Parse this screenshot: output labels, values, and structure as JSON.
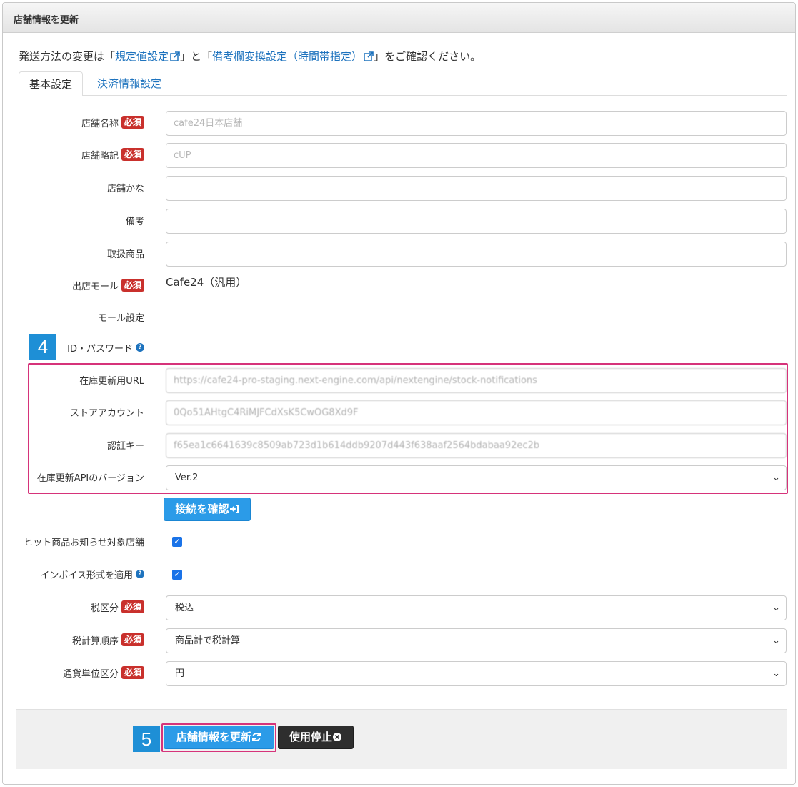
{
  "header": {
    "title": "店舗情報を更新"
  },
  "notice": {
    "prefix": "発送方法の変更は「",
    "link1": "規定値設定",
    "middle": "」と「",
    "link2": "備考欄変換設定（時間帯指定）",
    "suffix": "」をご確認ください。"
  },
  "tabs": {
    "basic": "基本設定",
    "payment": "決済情報設定"
  },
  "required_label": "必須",
  "fields": {
    "shop_name": {
      "label": "店舗名称",
      "value": "cafe24日本店舗"
    },
    "shop_abbr": {
      "label": "店舗略記",
      "value": "cUP"
    },
    "shop_kana": {
      "label": "店舗かな",
      "value": ""
    },
    "remarks": {
      "label": "備考",
      "value": ""
    },
    "products": {
      "label": "取扱商品",
      "value": ""
    },
    "mall": {
      "label": "出店モール",
      "value": "Cafe24（汎用）"
    },
    "mall_settings": {
      "label": "モール設定"
    },
    "id_password": {
      "label": "ID・パスワード"
    },
    "stock_url": {
      "label": "在庫更新用URL",
      "value": "https://cafe24-pro-staging.next-engine.com/api/nextengine/stock-notifications"
    },
    "store_account": {
      "label": "ストアアカウント",
      "value": "0Qo51AHtgC4RiMJFCdXsK5CwOG8Xd9F"
    },
    "auth_key": {
      "label": "認証キー",
      "value": "f65ea1c6641639c8509ab723d1b614ddb9207d443f638aaf2564bdabaa92ec2b"
    },
    "api_version": {
      "label": "在庫更新APIのバージョン",
      "value": "Ver.2"
    },
    "hit_notify": {
      "label": "ヒット商品お知らせ対象店舗",
      "checked": true
    },
    "invoice": {
      "label": "インボイス形式を適用",
      "checked": true
    },
    "tax_type": {
      "label": "税区分",
      "value": "税込"
    },
    "tax_order": {
      "label": "税計算順序",
      "value": "商品計で税計算"
    },
    "currency": {
      "label": "通貨単位区分",
      "value": "円"
    }
  },
  "buttons": {
    "check_connection": "接続を確認",
    "update_shop": "店舗情報を更新",
    "stop_use": "使用停止"
  },
  "steps": {
    "step4": "4",
    "step5": "5"
  },
  "colors": {
    "accent": "#2b9be8",
    "required": "#c9302c",
    "highlight": "#d6337a",
    "badge": "#1e8fd6"
  }
}
